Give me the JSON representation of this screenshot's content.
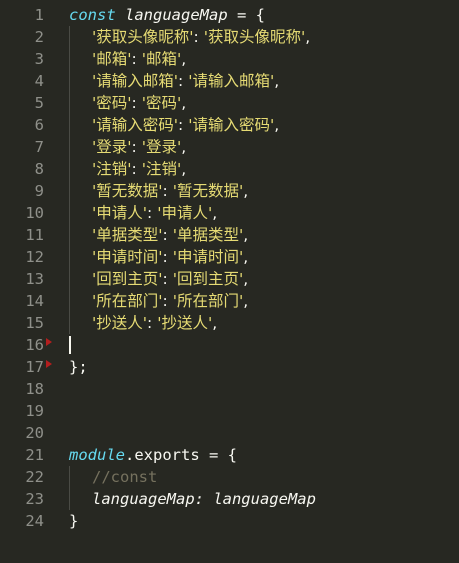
{
  "editor": {
    "line_numbers": [
      "1",
      "2",
      "3",
      "4",
      "5",
      "6",
      "7",
      "8",
      "9",
      "10",
      "11",
      "12",
      "13",
      "14",
      "15",
      "16",
      "17",
      "18",
      "19",
      "20",
      "21",
      "22",
      "23",
      "24"
    ],
    "lines": [
      {
        "kw": "const",
        "name": "languageMap",
        "rest": " = {"
      },
      {
        "key": "'获取头像昵称'",
        "sep": ": ",
        "val": "'获取头像昵称'",
        "end": ","
      },
      {
        "key": "'邮箱'",
        "sep": ": ",
        "val": "'邮箱'",
        "end": ","
      },
      {
        "key": "'请输入邮箱'",
        "sep": ": ",
        "val": "'请输入邮箱'",
        "end": ","
      },
      {
        "key": "'密码'",
        "sep": ": ",
        "val": "'密码'",
        "end": ","
      },
      {
        "key": "'请输入密码'",
        "sep": ": ",
        "val": "'请输入密码'",
        "end": ","
      },
      {
        "key": "'登录'",
        "sep": ": ",
        "val": "'登录'",
        "end": ","
      },
      {
        "key": "'注销'",
        "sep": ": ",
        "val": "'注销'",
        "end": ","
      },
      {
        "key": "'暂无数据'",
        "sep": ": ",
        "val": "'暂无数据'",
        "end": ","
      },
      {
        "key": "'申请人'",
        "sep": ": ",
        "val": "'申请人'",
        "end": ","
      },
      {
        "key": "'单据类型'",
        "sep": ": ",
        "val": "'单据类型'",
        "end": ","
      },
      {
        "key": "'申请时间'",
        "sep": ": ",
        "val": "'申请时间'",
        "end": ","
      },
      {
        "key": "'回到主页'",
        "sep": ": ",
        "val": "'回到主页'",
        "end": ","
      },
      {
        "key": "'所在部门'",
        "sep": ": ",
        "val": "'所在部门'",
        "end": ","
      },
      {
        "key": "'抄送人'",
        "sep": ": ",
        "val": "'抄送人'",
        "end": ","
      },
      {
        "text": ""
      },
      {
        "text": "};"
      },
      {
        "text": ""
      },
      {
        "text": ""
      },
      {
        "text": ""
      },
      {
        "obj": "module",
        "prop": ".exports",
        "rest": " = {"
      },
      {
        "comment": "//const"
      },
      {
        "text": "languageMap: languageMap"
      },
      {
        "text": "}"
      }
    ]
  }
}
